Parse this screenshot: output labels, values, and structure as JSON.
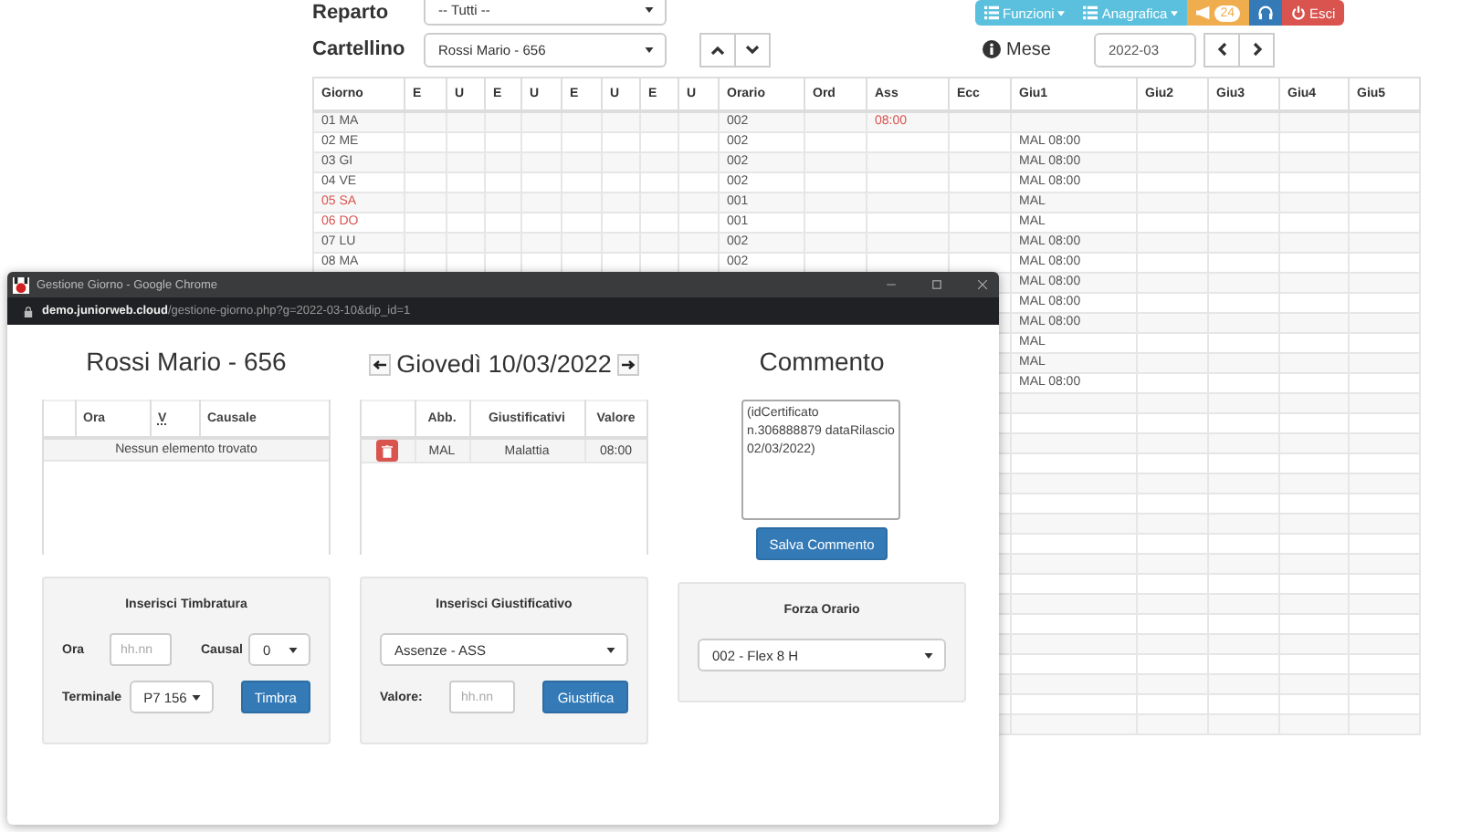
{
  "filters": [
    {
      "label": "Reparto",
      "value": "-- Tutti --"
    },
    {
      "label": "Cartellino",
      "value": "Rossi Mario - 656"
    }
  ],
  "menu": [
    {
      "kind": "dropdown",
      "label": "Funzioni",
      "color": "#5bc0de"
    },
    {
      "kind": "dropdown",
      "label": "Anagrafica",
      "color": "#5bc0de"
    },
    {
      "kind": "badge",
      "label": "24",
      "color": "#f0ad4e"
    },
    {
      "kind": "headset",
      "color": "#337ab7"
    },
    {
      "kind": "logout",
      "label": "Esci",
      "color": "#d9534f"
    }
  ],
  "month": {
    "label": "Mese",
    "value": "2022-03"
  },
  "table": {
    "columns": [
      "Giorno",
      "E",
      "U",
      "E",
      "U",
      "E",
      "U",
      "E",
      "U",
      "Orario",
      "Ord",
      "Ass",
      "Ecc",
      "Giu1",
      "Giu2",
      "Giu3",
      "Giu4",
      "Giu5"
    ],
    "rows": [
      {
        "giorno": "01 MA",
        "orario": "002",
        "ass": "08:00",
        "weekend": false
      },
      {
        "giorno": "02 ME",
        "orario": "002",
        "giu1": "MAL 08:00",
        "weekend": false
      },
      {
        "giorno": "03 GI",
        "orario": "002",
        "giu1": "MAL 08:00",
        "weekend": false
      },
      {
        "giorno": "04 VE",
        "orario": "002",
        "giu1": "MAL 08:00",
        "weekend": false
      },
      {
        "giorno": "05 SA",
        "orario": "001",
        "giu1": "MAL",
        "weekend": true
      },
      {
        "giorno": "06 DO",
        "orario": "001",
        "giu1": "MAL",
        "weekend": true
      },
      {
        "giorno": "07 LU",
        "orario": "002",
        "giu1": "MAL 08:00",
        "weekend": false
      },
      {
        "giorno": "08 MA",
        "orario": "002",
        "giu1": "MAL 08:00",
        "weekend": false
      },
      {
        "giu1": "MAL 08:00"
      },
      {
        "giu1": "MAL 08:00"
      },
      {
        "giu1": "MAL 08:00"
      },
      {
        "giu1": "MAL"
      },
      {
        "giu1": "MAL"
      },
      {
        "giu1": "MAL 08:00"
      }
    ]
  },
  "popup": {
    "window_title": "Gestione Giorno - Google Chrome",
    "url_host": "demo.juniorweb.cloud",
    "url_path": "/gestione-giorno.php?g=2022-03-10&dip_id=1",
    "employee": "Rossi Mario - 656",
    "day": "Giovedì 10/03/2022",
    "comment_title": "Commento",
    "stamps": {
      "columns": [
        "Ora",
        "V",
        "Causale"
      ],
      "empty": "Nessun elemento trovato"
    },
    "justifications": {
      "columns": [
        "Abb.",
        "Giustificativi",
        "Valore"
      ],
      "rows": [
        {
          "abb": "MAL",
          "name": "Malattia",
          "value": "08:00"
        }
      ]
    },
    "comment": "(idCertificato n.306888879 dataRilascio 02/03/2022)",
    "save_button": "Salva Commento",
    "stamp_panel": {
      "title": "Inserisci Timbratura",
      "time_label": "Ora",
      "time_placeholder": "hh.nn",
      "cause_label": "Causal",
      "cause_value": "0",
      "terminal_label": "Terminale",
      "terminal_value": "P7 156",
      "button": "Timbra"
    },
    "justify_panel": {
      "title": "Inserisci Giustificativo",
      "type_value": "Assenze - ASS",
      "value_label": "Valore:",
      "value_placeholder": "hh.nn",
      "button": "Giustifica"
    },
    "schedule_panel": {
      "title": "Forza Orario",
      "value": "002 - Flex 8 H"
    }
  }
}
